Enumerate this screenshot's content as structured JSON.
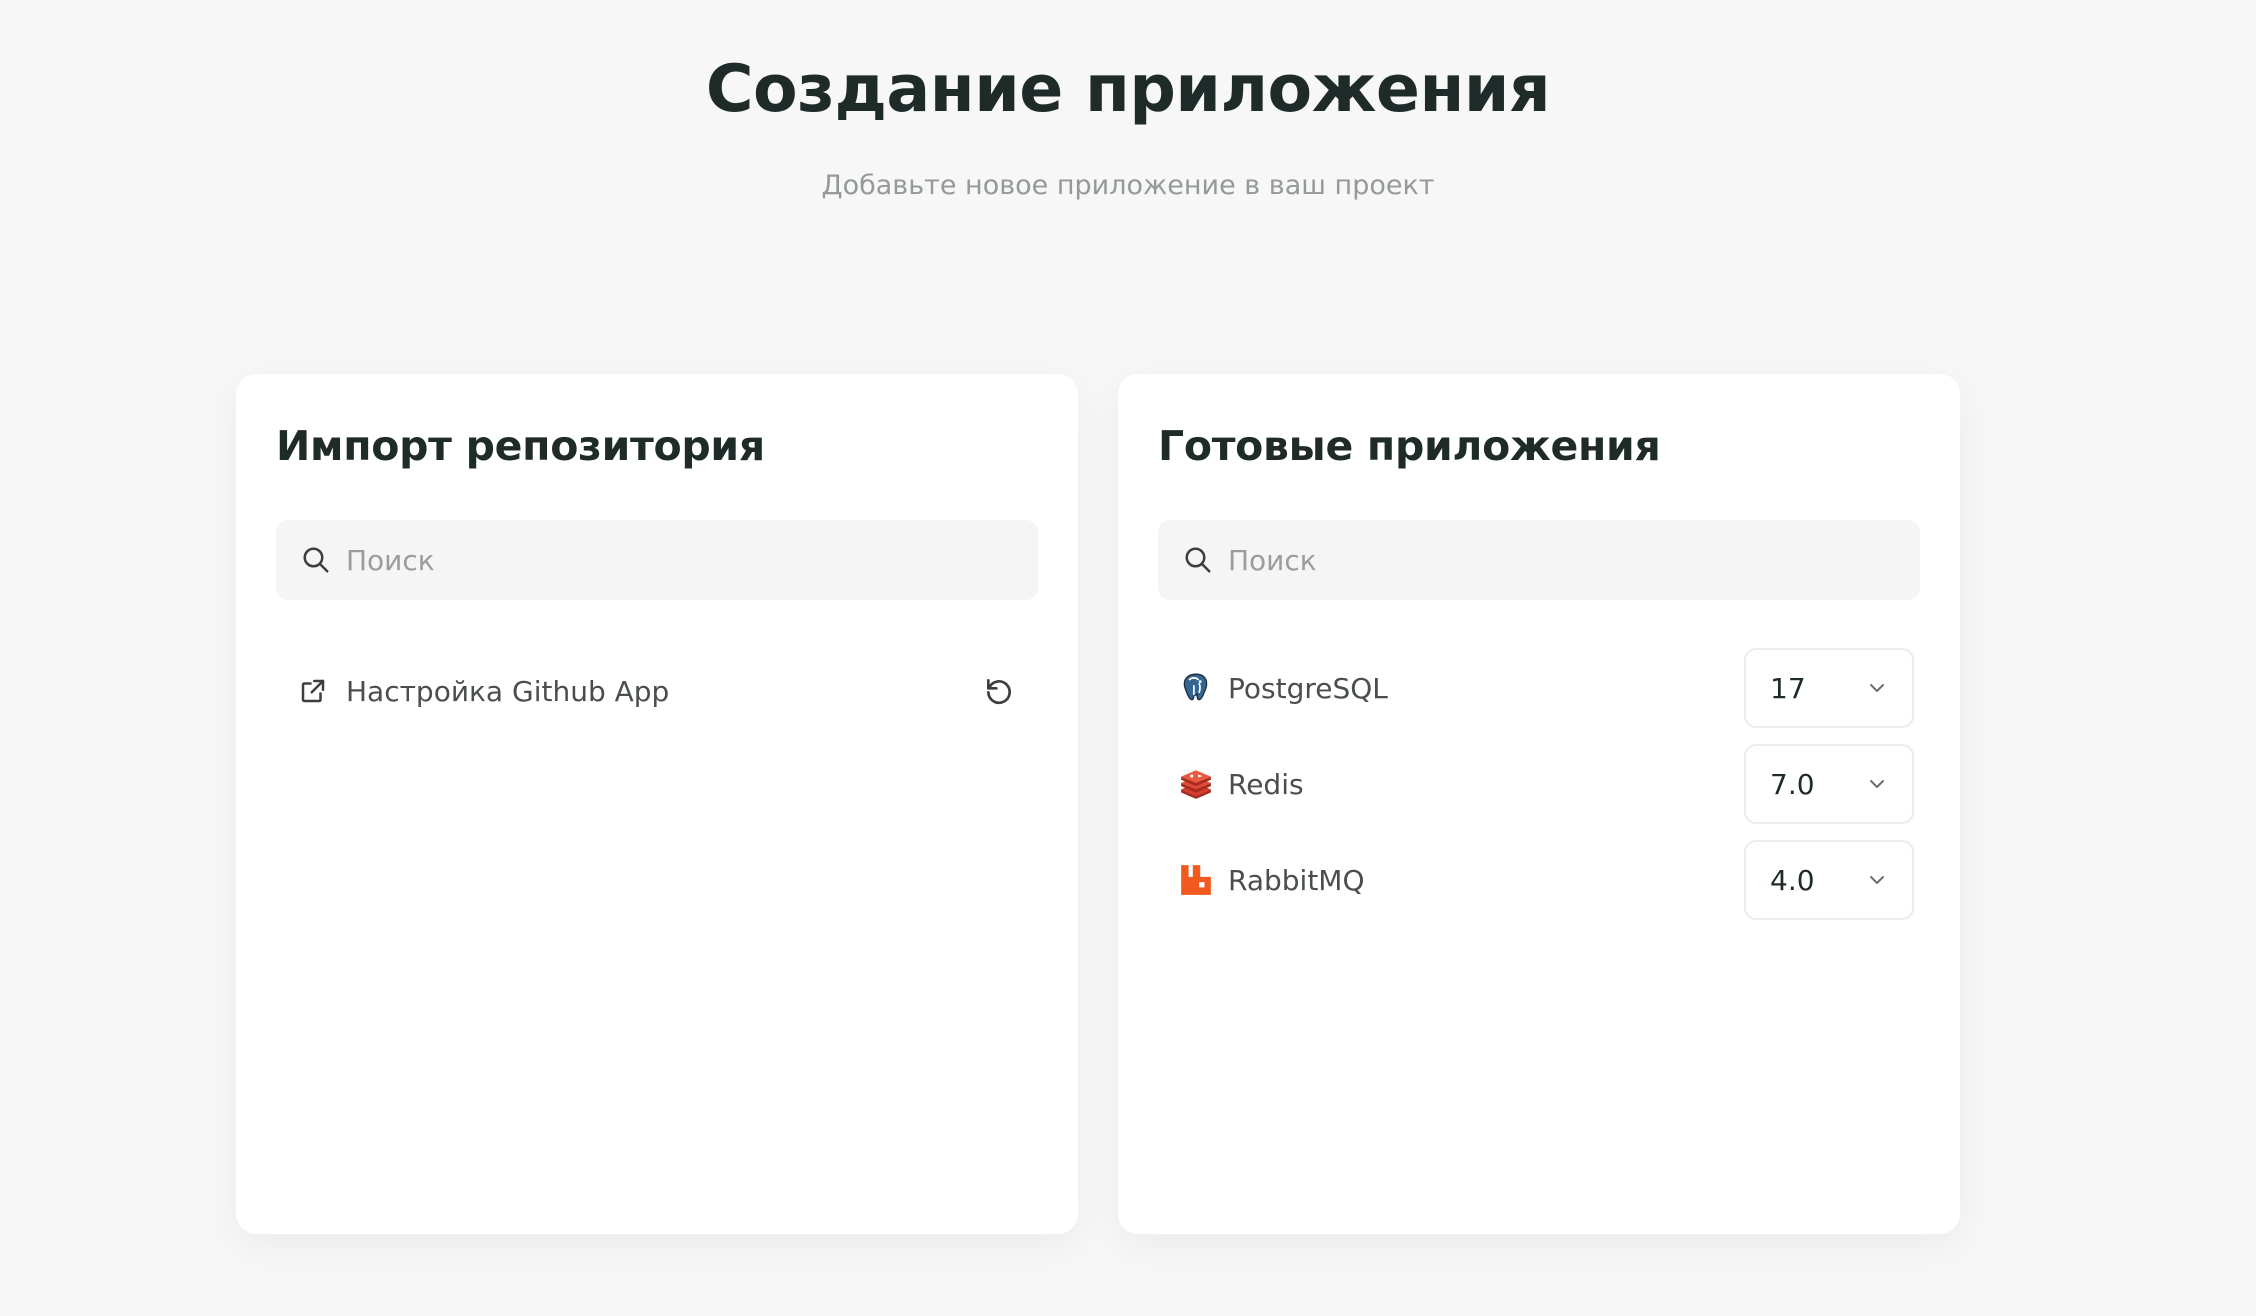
{
  "header": {
    "title": "Создание приложения",
    "subtitle": "Добавьте новое приложение в ваш проект"
  },
  "import_card": {
    "title": "Импорт репозитория",
    "search": {
      "placeholder": "Поиск",
      "value": ""
    },
    "github_setup_label": "Настройка Github App"
  },
  "ready_apps_card": {
    "title": "Готовые приложения",
    "search": {
      "placeholder": "Поиск",
      "value": ""
    },
    "apps": [
      {
        "name": "PostgreSQL",
        "version": "17",
        "icon": "postgresql-icon"
      },
      {
        "name": "Redis",
        "version": "7.0",
        "icon": "redis-icon"
      },
      {
        "name": "RabbitMQ",
        "version": "4.0",
        "icon": "rabbitmq-icon"
      }
    ]
  },
  "colors": {
    "background": "#f7f7f7",
    "card": "#ffffff",
    "search_bg": "#f5f5f5",
    "title": "#1e2b29",
    "redis": "#d63a2a",
    "rabbitmq": "#f05a1f",
    "postgres": "#336791"
  }
}
